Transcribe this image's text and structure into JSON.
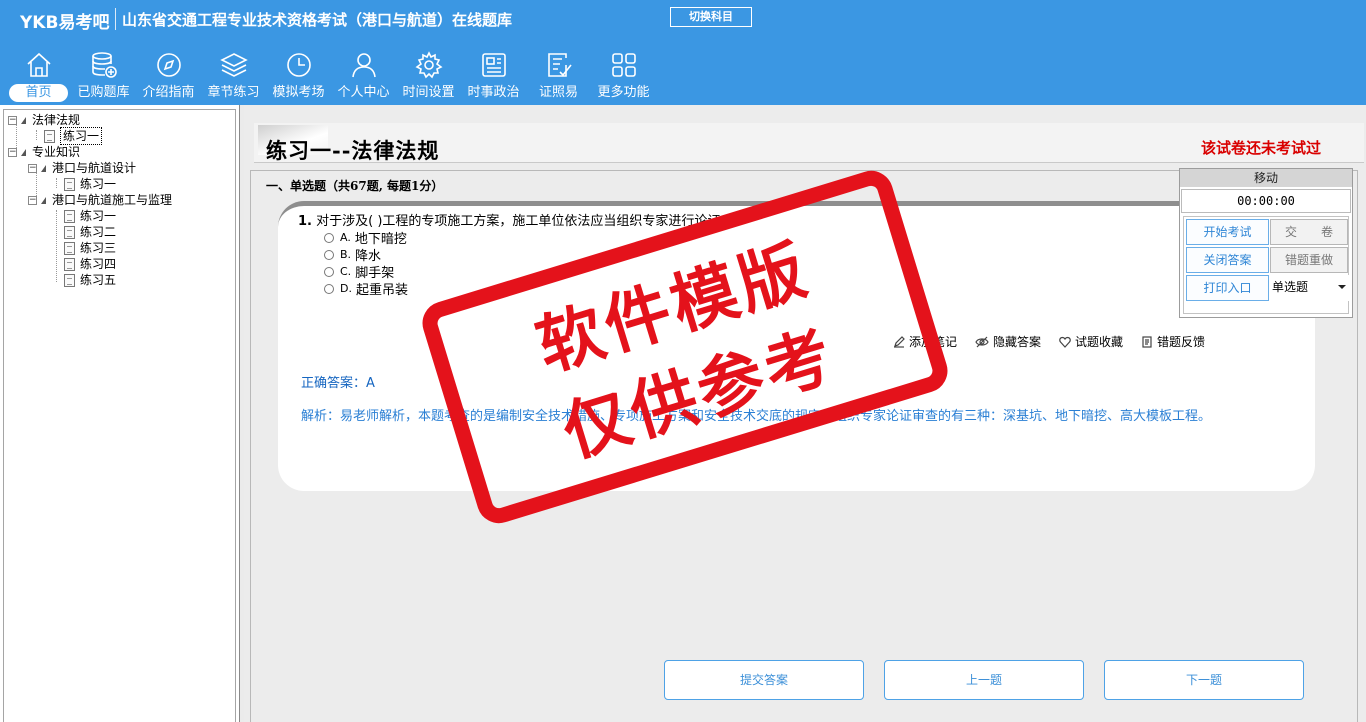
{
  "header": {
    "brand": "YKB易考吧",
    "title": "山东省交通工程专业技术资格考试（港口与航道）在线题库",
    "switch_label": "切换科目"
  },
  "nav": [
    {
      "label": "首页",
      "icon": "home-icon"
    },
    {
      "label": "已购题库",
      "icon": "database-icon"
    },
    {
      "label": "介绍指南",
      "icon": "compass-icon"
    },
    {
      "label": "章节练习",
      "icon": "layers-icon"
    },
    {
      "label": "模拟考场",
      "icon": "clock-icon"
    },
    {
      "label": "个人中心",
      "icon": "user-icon"
    },
    {
      "label": "时间设置",
      "icon": "gear-icon"
    },
    {
      "label": "时事政治",
      "icon": "news-icon"
    },
    {
      "label": "证照易",
      "icon": "checklist-icon"
    },
    {
      "label": "更多功能",
      "icon": "grid-icon"
    }
  ],
  "tree": {
    "law": "法律法规",
    "law_ex1": "练习一",
    "pro": "专业知识",
    "design": "港口与航道设计",
    "design_ex1": "练习一",
    "construct": "港口与航道施工与监理",
    "c_ex": [
      "练习一",
      "练习二",
      "练习三",
      "练习四",
      "练习五"
    ]
  },
  "main": {
    "paper_title": "练习一--法律法规",
    "exam_status": "该试卷还未考试过",
    "section": "一、单选题（共67题, 每题1分）",
    "question_no": "1.",
    "question": "对于涉及( )工程的专项施工方案，施工单位依法应当组织专家进行论证",
    "options": [
      {
        "letter": "A.",
        "text": "地下暗挖"
      },
      {
        "letter": "B.",
        "text": "降水"
      },
      {
        "letter": "C.",
        "text": "脚手架"
      },
      {
        "letter": "D.",
        "text": "起重吊装"
      }
    ],
    "tools": [
      "添加笔记",
      "隐藏答案",
      "试题收藏",
      "错题反馈"
    ],
    "answer_label": "正确答案：",
    "answer_value": "A",
    "analysis": "解析：易老师解析，本题考查的是编制安全技术措施、专项施工方案和安全技术交底的规定。组织专家论证审查的有三种：深基坑、地下暗挖、高大模板工程。"
  },
  "bottom": {
    "submit": "提交答案",
    "prev": "上一题",
    "next": "下一题"
  },
  "panel": {
    "move": "移动",
    "timer": "00:00:00",
    "start": "开始考试",
    "hand_in": "交　　卷",
    "close_answer": "关闭答案",
    "redo": "错题重做",
    "print": "打印入口",
    "type_select": "单选题"
  },
  "watermark": {
    "line1": "软件模版",
    "line2": "仅供参考"
  },
  "colors": {
    "header_bg": "#3b97e3",
    "stamp": "#e4121b",
    "status_red": "#d90000",
    "answer_blue": "#1565c0"
  }
}
